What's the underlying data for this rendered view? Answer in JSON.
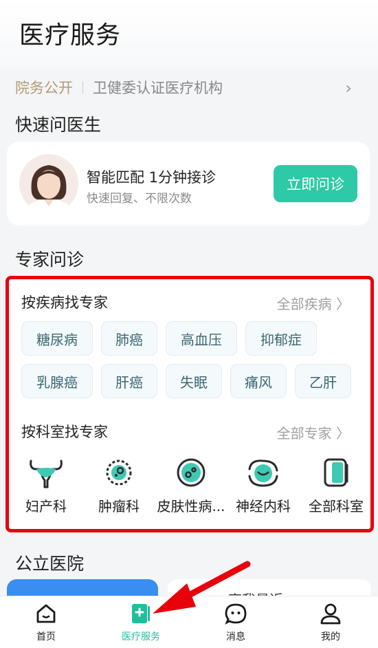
{
  "header": {
    "title": "医疗服务"
  },
  "cert_bar": {
    "tag": "院务公开",
    "text": "卫健委认证医疗机构"
  },
  "quick": {
    "section_title": "快速问医生",
    "main_text": "智能匹配 1分钟接诊",
    "sub_text": "快速回复、不限次数",
    "button": "立即问诊"
  },
  "expert": {
    "section_title": "专家问诊",
    "by_disease": {
      "title": "按疾病找专家",
      "more": "全部疾病 〉",
      "chips_row1": [
        "糖尿病",
        "肺癌",
        "高血压",
        "抑郁症"
      ],
      "chips_row2": [
        "乳腺癌",
        "肝癌",
        "失眠",
        "痛风",
        "乙肝"
      ]
    },
    "by_dept": {
      "title": "按科室找专家",
      "more": "全部专家 〉",
      "departments": [
        {
          "label": "妇产科",
          "icon": "uterus-icon"
        },
        {
          "label": "肿瘤科",
          "icon": "tumor-cell-icon"
        },
        {
          "label": "皮肤性病...",
          "icon": "skin-cell-icon"
        },
        {
          "label": "神经内科",
          "icon": "brain-orbit-icon"
        },
        {
          "label": "全部科室",
          "icon": "all-departments-icon"
        }
      ]
    }
  },
  "public_hospital": {
    "section_title": "公立医院",
    "card_b_text": "离我最近"
  },
  "tabbar": {
    "items": [
      {
        "label": "首页",
        "icon": "home-icon"
      },
      {
        "label": "医疗服务",
        "icon": "medical-book-icon",
        "active": true
      },
      {
        "label": "消息",
        "icon": "chat-icon"
      },
      {
        "label": "我的",
        "icon": "profile-icon"
      }
    ]
  },
  "colors": {
    "accent": "#2ec9a6",
    "highlight_border": "#e8000b",
    "annotation_arrow": "#e8000b"
  }
}
